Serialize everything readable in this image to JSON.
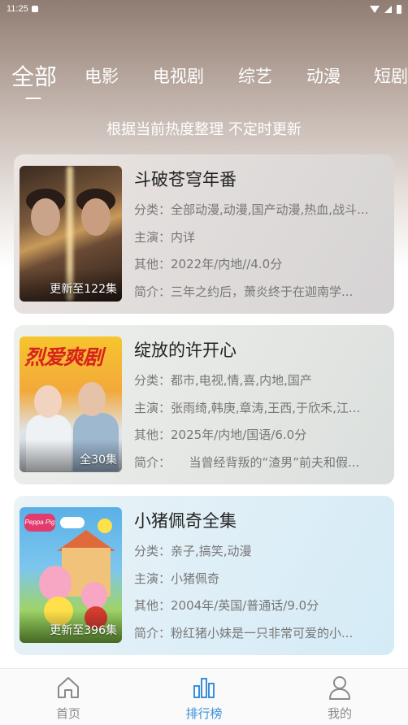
{
  "status_bar": {
    "time": "11:25"
  },
  "tabs": [
    {
      "label": "全部",
      "active": true
    },
    {
      "label": "电影",
      "active": false
    },
    {
      "label": "电视剧",
      "active": false
    },
    {
      "label": "综艺",
      "active": false
    },
    {
      "label": "动漫",
      "active": false
    },
    {
      "label": "短剧",
      "active": false
    }
  ],
  "subtitle": "根据当前热度整理 不定时更新",
  "items": [
    {
      "title": "斗破苍穹年番",
      "badge": "更新至122集",
      "category": "分类：全部动漫,动漫,国产动漫,热血,战斗...",
      "cast": "主演：内详",
      "other": "其他：2022年/内地//4.0分",
      "summary": "简介：三年之约后，萧炎终于在迦南学..."
    },
    {
      "title": "绽放的许开心",
      "badge": "全30集",
      "poster_text": "烈爱爽剧",
      "category": "分类：都市,电视,情,喜,内地,国产",
      "cast": "主演：张雨绮,韩庚,章涛,王西,于欣禾,江...",
      "other": "其他：2025年/内地/国语/6.0分",
      "summary": "简介：　　当曾经背叛的“渣男”前夫和假..."
    },
    {
      "title": "小猪佩奇全集",
      "badge": "更新至396集",
      "poster_text": "Peppa Pig",
      "category": "分类：亲子,搞笑,动漫",
      "cast": "主演：小猪佩奇",
      "other": "其他：2004年/英国/普通话/9.0分",
      "summary": "简介：粉红猪小妹是一只非常可爱的小..."
    }
  ],
  "bottom_nav": [
    {
      "label": "首页",
      "icon": "home-icon",
      "active": false
    },
    {
      "label": "排行榜",
      "icon": "bar-chart-icon",
      "active": true
    },
    {
      "label": "我的",
      "icon": "user-icon",
      "active": false
    }
  ],
  "colors": {
    "accent": "#3b8fd8",
    "nav_inactive": "#8a8a8a",
    "title_text": "#222222",
    "meta_text": "#777777"
  }
}
